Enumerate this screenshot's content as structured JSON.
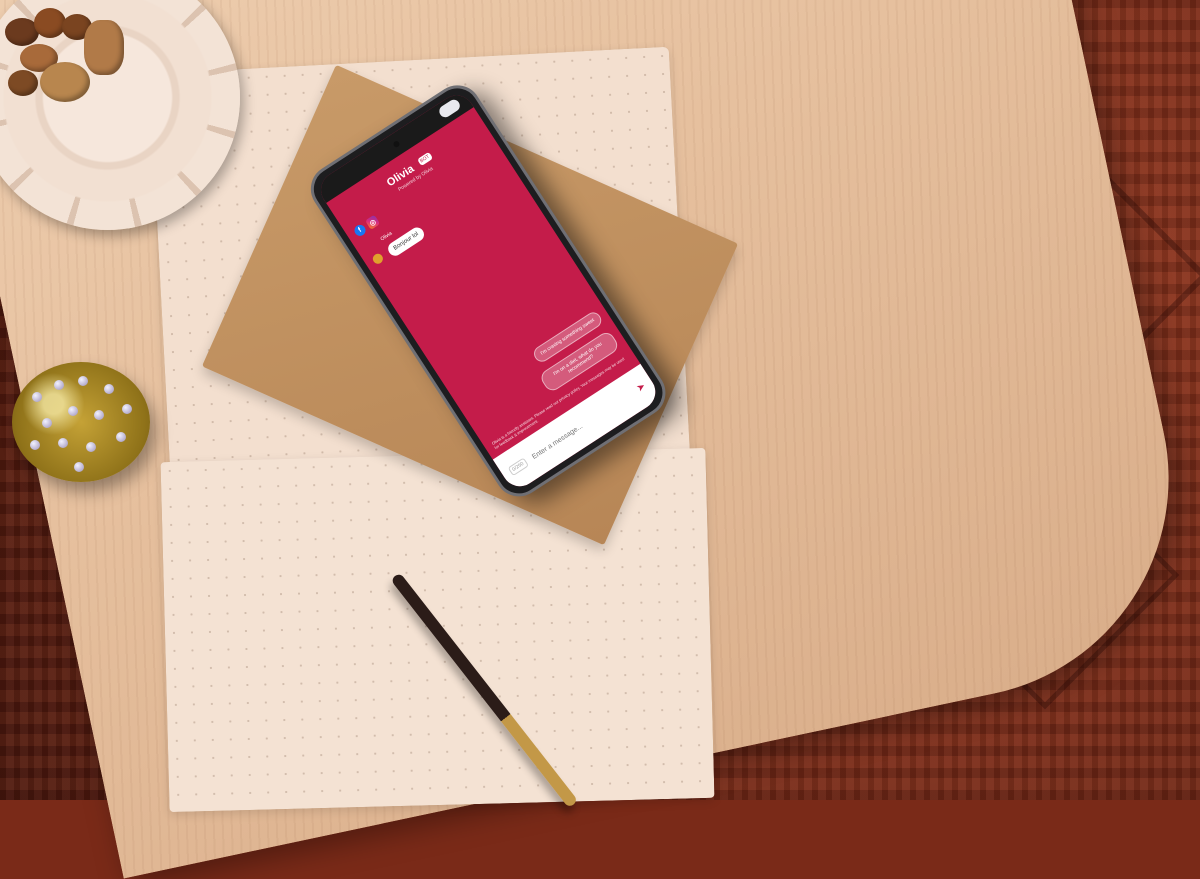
{
  "chat": {
    "bot_name": "Olivia",
    "badge": "BOT",
    "powered_by": "Powered by Olivia",
    "sender_label": "Olivia",
    "greeting": "Bonjour lol",
    "quick_replies": [
      "I'm on a diet, what do you recommend?",
      "I'm craving something sweet"
    ],
    "disclaimer": "Olivia is a friendly assistant. Please read our privacy policy. Your messages may be used for feedback & improvement.",
    "input_placeholder": "Enter a message...",
    "char_count": "0/250"
  },
  "colors": {
    "brand": "#c41c4a",
    "facebook": "#1877f2"
  },
  "icons": [
    "facebook-icon",
    "instagram-icon",
    "send-icon",
    "toggle-switch"
  ]
}
